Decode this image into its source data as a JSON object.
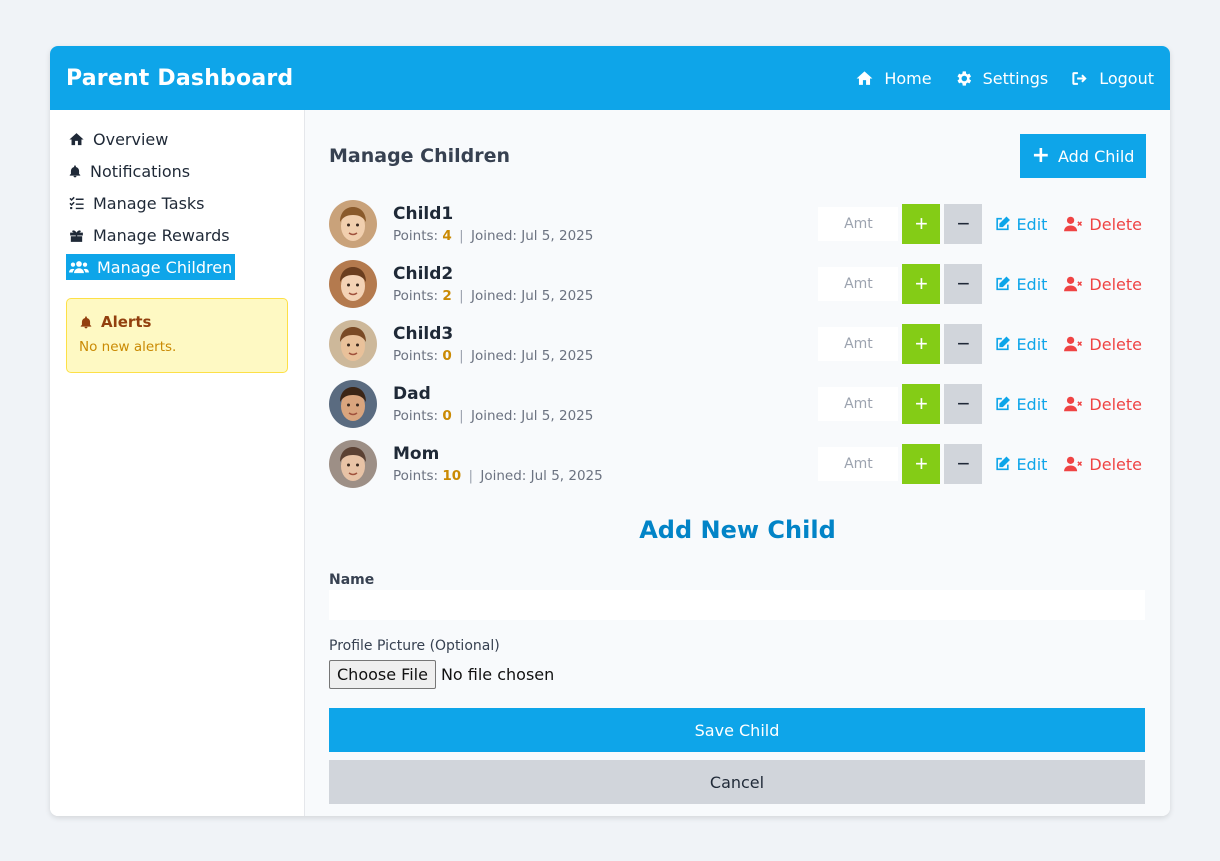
{
  "header": {
    "title": "Parent Dashboard",
    "nav": [
      {
        "label": "Home",
        "icon": "home-icon"
      },
      {
        "label": "Settings",
        "icon": "gear-icon"
      },
      {
        "label": "Logout",
        "icon": "logout-icon"
      }
    ]
  },
  "sidebar": {
    "items": [
      {
        "label": "Overview",
        "icon": "home-icon"
      },
      {
        "label": "Notifications",
        "icon": "bell-icon"
      },
      {
        "label": "Manage Tasks",
        "icon": "checklist-icon"
      },
      {
        "label": "Manage Rewards",
        "icon": "gift-icon"
      },
      {
        "label": "Manage Children",
        "icon": "users-icon",
        "active": true
      }
    ],
    "alerts": {
      "title": "Alerts",
      "text": "No new alerts."
    }
  },
  "main": {
    "title": "Manage Children",
    "add_button": "Add Child",
    "children": [
      {
        "name": "Child1",
        "points_label": "Points:",
        "points": "4",
        "joined": "Joined: Jul 5, 2025"
      },
      {
        "name": "Child2",
        "points_label": "Points:",
        "points": "2",
        "joined": "Joined: Jul 5, 2025"
      },
      {
        "name": "Child3",
        "points_label": "Points:",
        "points": "0",
        "joined": "Joined: Jul 5, 2025"
      },
      {
        "name": "Dad",
        "points_label": "Points:",
        "points": "0",
        "joined": "Joined: Jul 5, 2025"
      },
      {
        "name": "Mom",
        "points_label": "Points:",
        "points": "10",
        "joined": "Joined: Jul 5, 2025"
      }
    ],
    "amount_placeholder": "Amt",
    "plus_label": "+",
    "minus_label": "−",
    "edit_label": "Edit",
    "delete_label": "Delete",
    "separator": "|"
  },
  "form": {
    "title": "Add New Child",
    "name_label": "Name",
    "name_value": "",
    "picture_label": "Profile Picture (Optional)",
    "choose_file": "Choose File",
    "no_file": "No file chosen",
    "save": "Save Child",
    "cancel": "Cancel"
  },
  "colors": {
    "accent": "#0ea5e9",
    "plus_button": "#84cc16",
    "delete": "#ef4444",
    "points": "#ca8a04"
  }
}
